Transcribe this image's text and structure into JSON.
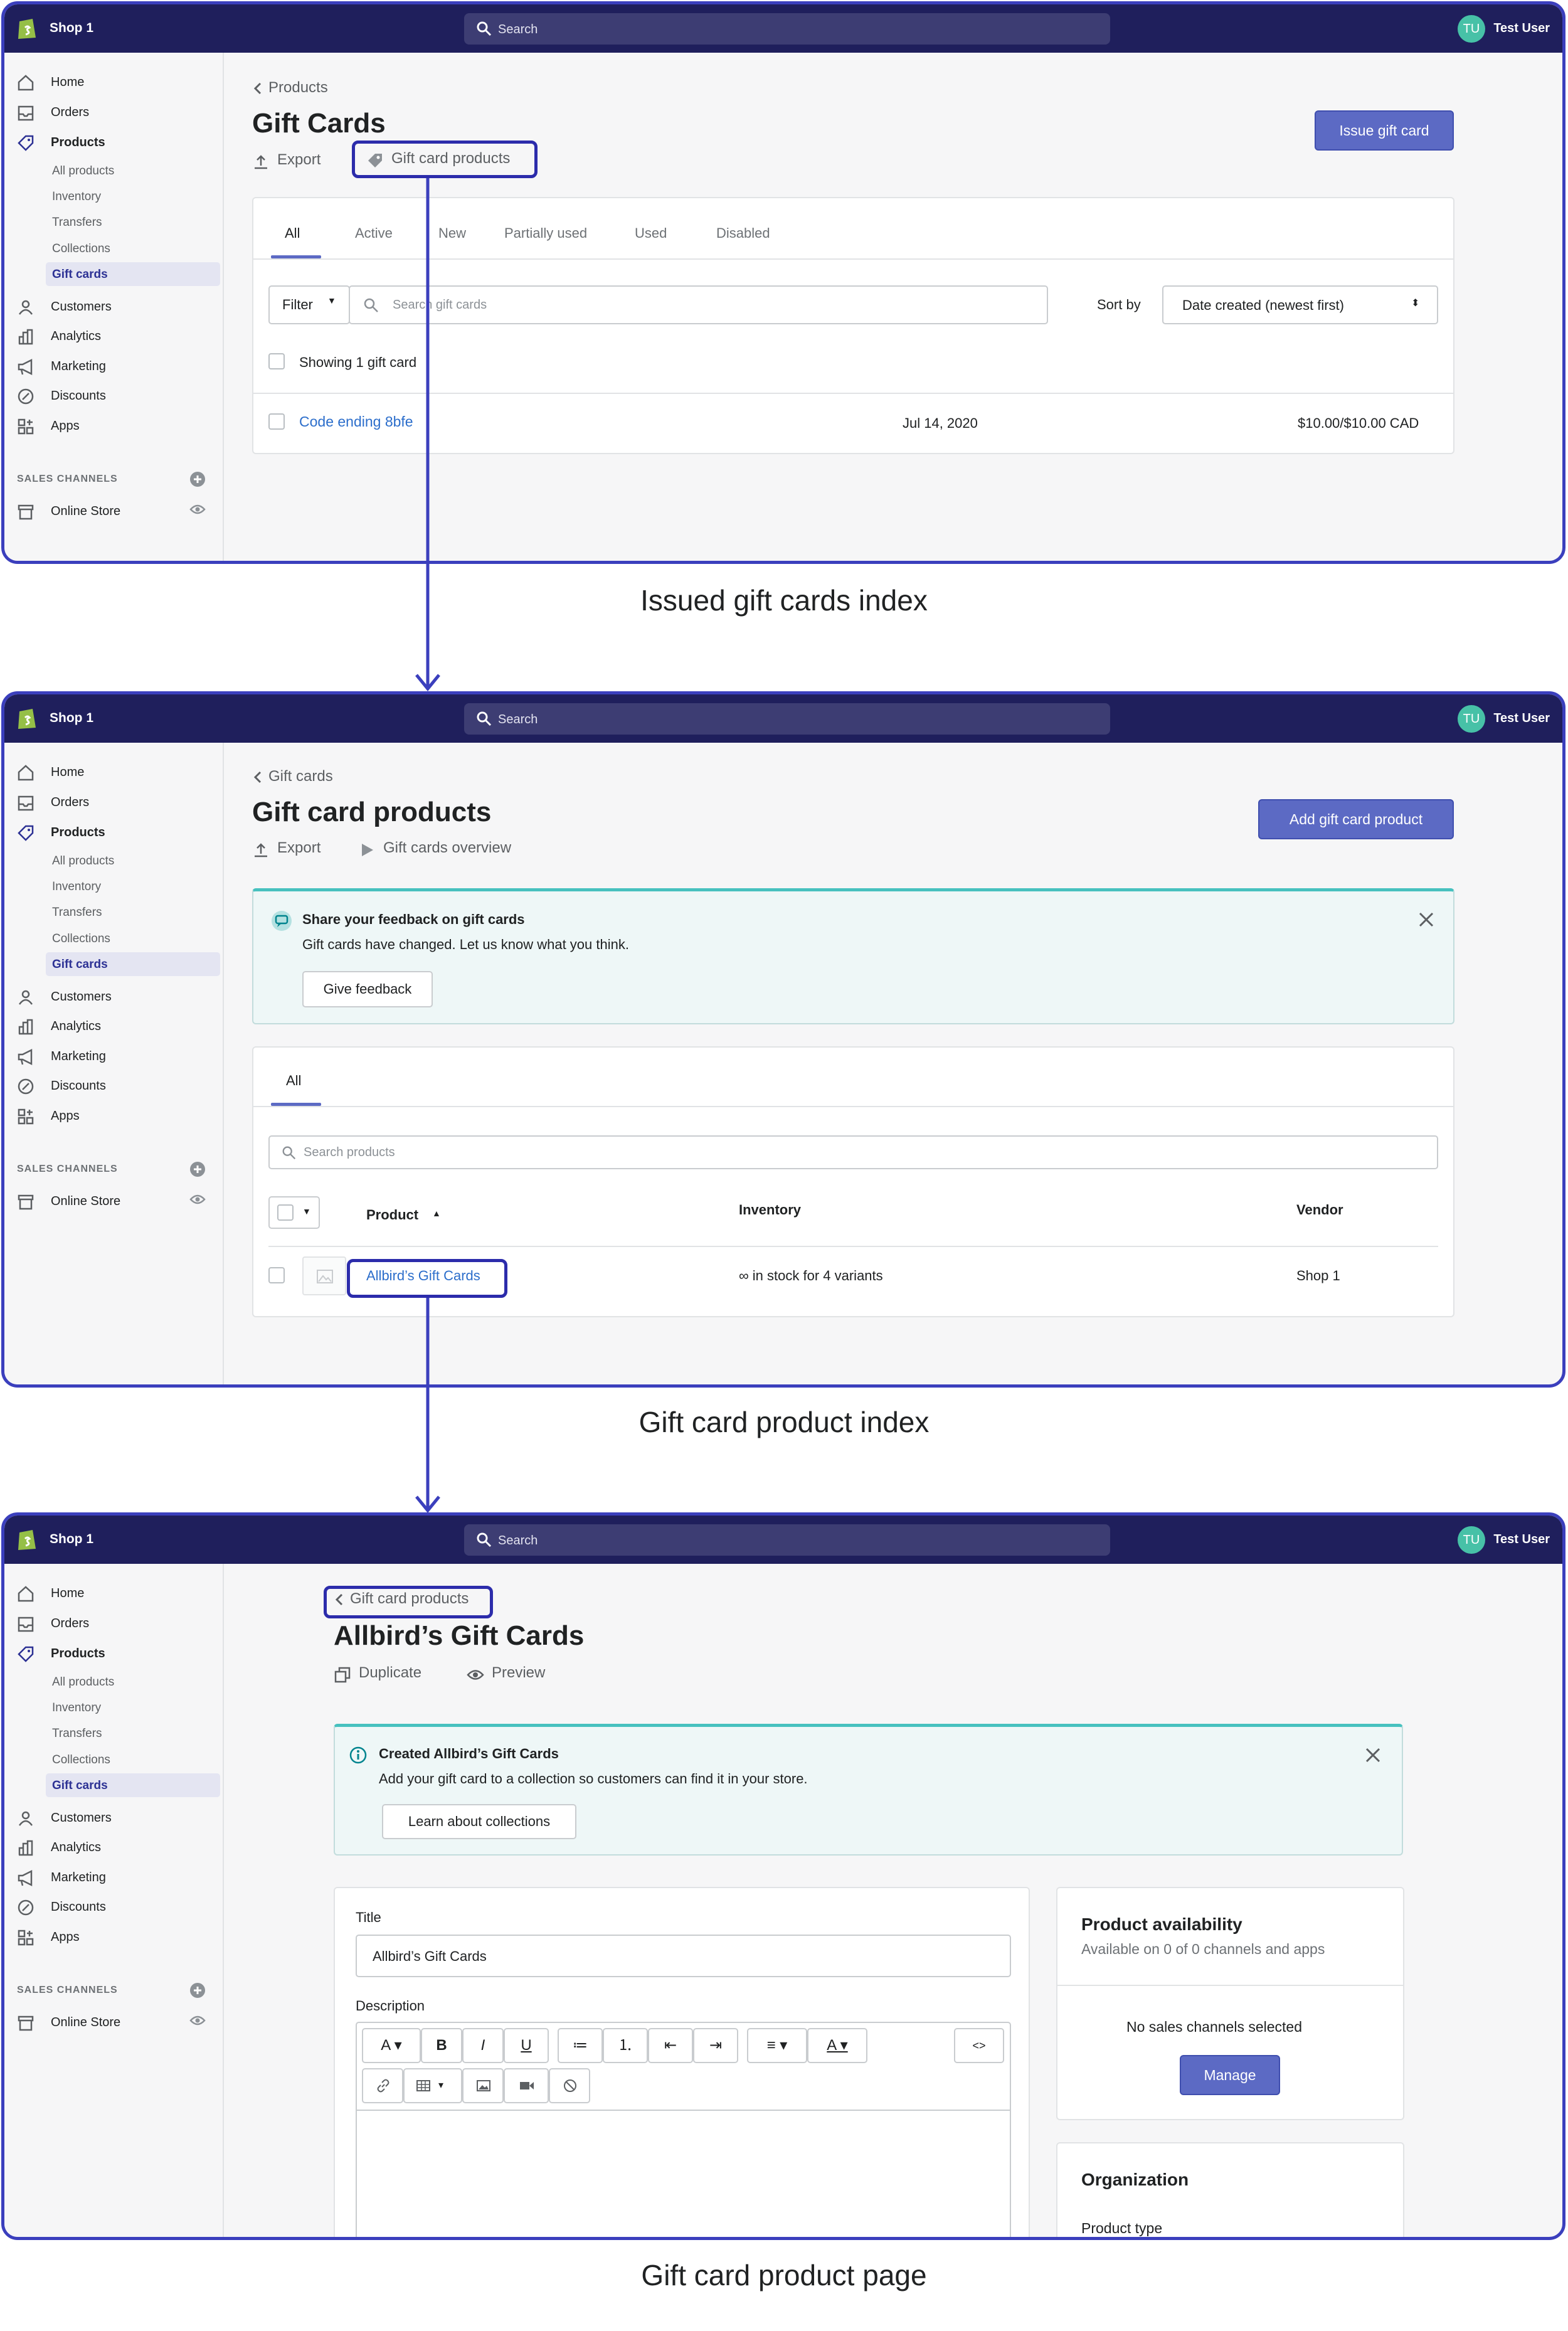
{
  "common": {
    "shop_name": "Shop 1",
    "search_placeholder": "Search",
    "user_initials": "TU",
    "user_name": "Test User",
    "nav": {
      "home": "Home",
      "orders": "Orders",
      "products": "Products",
      "products_sub": [
        "All products",
        "Inventory",
        "Transfers",
        "Collections",
        "Gift cards"
      ],
      "customers": "Customers",
      "analytics": "Analytics",
      "marketing": "Marketing",
      "discounts": "Discounts",
      "apps": "Apps",
      "sales_channels_label": "SALES CHANNELS",
      "online_store": "Online Store"
    }
  },
  "colors": {
    "topbar": "#1f1f5c",
    "primary_button": "#5c6ac4",
    "highlight_outline": "#2c2cab",
    "link": "#2c6ecb",
    "avatar": "#47c1a7"
  },
  "screen1": {
    "breadcrumb": "Products",
    "title": "Gift Cards",
    "export": "Export",
    "gift_card_products": "Gift card products",
    "issue_button": "Issue gift card",
    "tabs": [
      "All",
      "Active",
      "New",
      "Partially used",
      "Used",
      "Disabled"
    ],
    "filter": "Filter",
    "search_placeholder": "Search gift cards",
    "sort_by_label": "Sort by",
    "sort_value": "Date created (newest first)",
    "showing": "Showing 1 gift card",
    "row": {
      "code": "Code ending 8bfe",
      "date": "Jul 14, 2020",
      "amount": "$10.00/$10.00 CAD"
    },
    "caption": "Issued gift cards index"
  },
  "screen2": {
    "breadcrumb": "Gift cards",
    "title": "Gift card products",
    "export": "Export",
    "overview": "Gift cards overview",
    "add_button": "Add gift card product",
    "banner_title": "Share your feedback on gift cards",
    "banner_text": "Gift cards have changed. Let us know what you think.",
    "banner_button": "Give feedback",
    "tab": "All",
    "search_placeholder": "Search products",
    "columns": [
      "Product",
      "Inventory",
      "Vendor"
    ],
    "row": {
      "name": "Allbird’s Gift Cards",
      "inventory": "∞ in stock for 4 variants",
      "vendor": "Shop 1"
    },
    "caption": "Gift card product index"
  },
  "screen3": {
    "breadcrumb": "Gift card products",
    "title": "Allbird’s Gift Cards",
    "duplicate": "Duplicate",
    "preview": "Preview",
    "banner_title": "Created Allbird’s Gift Cards",
    "banner_text": "Add your gift card to a collection so customers can find it in your store.",
    "banner_button": "Learn about collections",
    "title_label": "Title",
    "title_value": "Allbird’s Gift Cards",
    "description_label": "Description",
    "toolbar_row1": [
      "A",
      "B",
      "I",
      "U",
      "≔",
      "⒈",
      "⇤",
      "⇥",
      "≡",
      "A",
      "<>"
    ],
    "availability_title": "Product availability",
    "availability_sub": "Available on 0 of 0 channels and apps",
    "no_channels": "No sales channels selected",
    "manage": "Manage",
    "organization": "Organization",
    "product_type": "Product type",
    "caption": "Gift card product page"
  }
}
